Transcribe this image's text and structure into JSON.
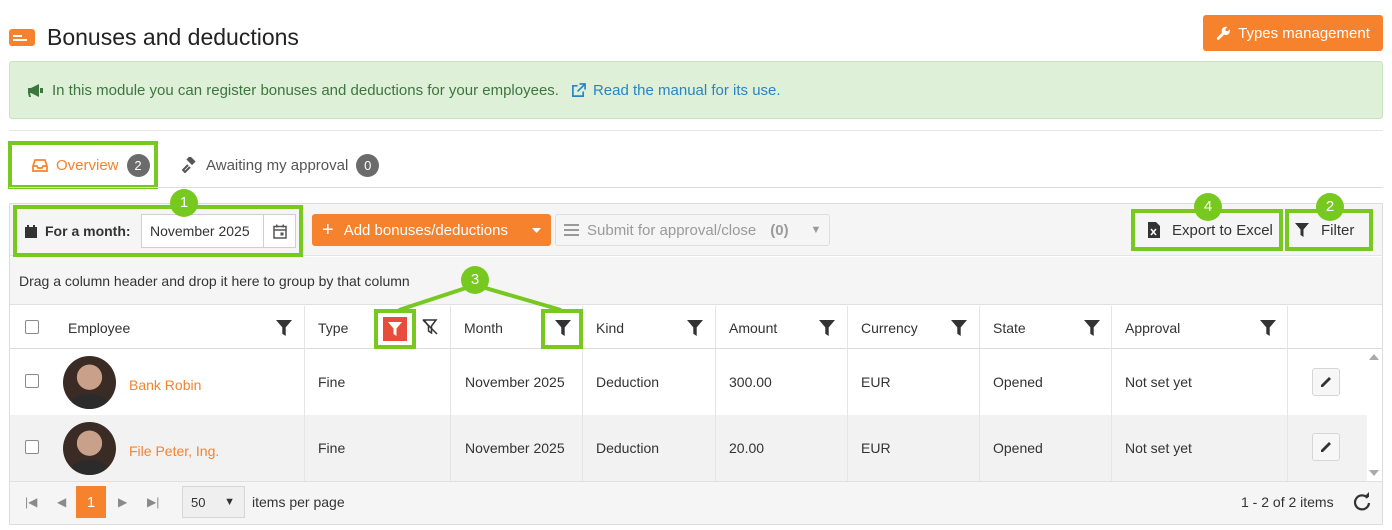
{
  "header": {
    "title": "Bonuses and deductions",
    "types_button": "Types management",
    "accent": "#f6822d"
  },
  "info": {
    "text": "In this module you can register bonuses and deductions for your employees.",
    "link": "Read the manual for its use."
  },
  "tabs": [
    {
      "label": "Overview",
      "count": "2",
      "active": true
    },
    {
      "label": "Awaiting my approval",
      "count": "0",
      "active": false
    }
  ],
  "toolbar": {
    "month_label": "For a month:",
    "month_value": "November 2025",
    "add_label": "Add bonuses/deductions",
    "submit_label": "Submit for approval/close",
    "submit_count": "(0)",
    "export_label": "Export to Excel",
    "filter_label": "Filter"
  },
  "group_hint": "Drag a column header and drop it here to group by that column",
  "columns": [
    "Employee",
    "Type",
    "Month",
    "Kind",
    "Amount",
    "Currency",
    "State",
    "Approval"
  ],
  "rows": [
    {
      "employee": "Bank Robin",
      "type": "Fine",
      "month": "November 2025",
      "kind": "Deduction",
      "amount": "300.00",
      "currency": "EUR",
      "state": "Opened",
      "approval": "Not set yet"
    },
    {
      "employee": "File Peter, Ing.",
      "type": "Fine",
      "month": "November 2025",
      "kind": "Deduction",
      "amount": "20.00",
      "currency": "EUR",
      "state": "Opened",
      "approval": "Not set yet"
    }
  ],
  "pager": {
    "current_page": "1",
    "page_size": "50",
    "items_per_page": "items per page",
    "count": "1 - 2 of 2 items"
  },
  "callouts": [
    "1",
    "2",
    "3",
    "4"
  ],
  "highlight_color": "#77c920"
}
